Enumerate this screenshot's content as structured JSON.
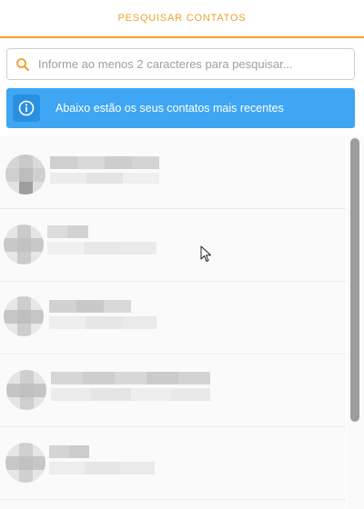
{
  "header": {
    "title": "PESQUISAR CONTATOS"
  },
  "search": {
    "icon": "search-icon",
    "placeholder": "Informe ao menos 2 caracteres para pesquisar...",
    "value": ""
  },
  "info": {
    "icon": "info-icon",
    "text": "Abaixo estão os seus contatos mais recentes"
  },
  "colors": {
    "accent": "#f0a030",
    "info_bg": "#3ea6f3",
    "info_icon_bg": "#2b8fe0"
  },
  "contacts_visible": 5
}
